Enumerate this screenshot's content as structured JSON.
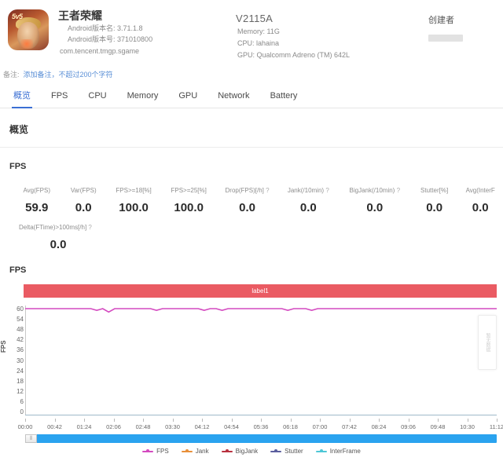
{
  "header": {
    "app": {
      "icon_name": "game-app-icon",
      "title": "王者荣耀",
      "version_name_line": "Android版本名: 3.71.1.8",
      "version_code_line": "Android版本号: 371010800",
      "package": "com.tencent.tmgp.sgame"
    },
    "device": {
      "model": "V2115A",
      "memory": "Memory: 11G",
      "cpu": "CPU: lahaina",
      "gpu": "GPU: Qualcomm Adreno (TM) 642L"
    },
    "creator": {
      "title": "创建者",
      "value": ""
    },
    "remark": {
      "label": "备注:",
      "placeholder": "添加备注，不超过200个字符"
    }
  },
  "tabs": [
    {
      "label": "概览",
      "active": true
    },
    {
      "label": "FPS",
      "active": false
    },
    {
      "label": "CPU",
      "active": false
    },
    {
      "label": "Memory",
      "active": false
    },
    {
      "label": "GPU",
      "active": false
    },
    {
      "label": "Network",
      "active": false
    },
    {
      "label": "Battery",
      "active": false
    }
  ],
  "overview": {
    "section_title": "概览"
  },
  "fps_block": {
    "title": "FPS",
    "metrics_row1": [
      {
        "label": "Avg(FPS)",
        "value": "59.9",
        "help": false
      },
      {
        "label": "Var(FPS)",
        "value": "0.0",
        "help": false
      },
      {
        "label": "FPS>=18[%]",
        "value": "100.0",
        "help": false
      },
      {
        "label": "FPS>=25[%]",
        "value": "100.0",
        "help": false
      },
      {
        "label": "Drop(FPS)[/h]",
        "value": "0.0",
        "help": true
      },
      {
        "label": "Jank(/10min)",
        "value": "0.0",
        "help": true
      },
      {
        "label": "BigJank(/10min)",
        "value": "0.0",
        "help": true
      },
      {
        "label": "Stutter[%]",
        "value": "0.0",
        "help": false
      },
      {
        "label": "Avg(InterF",
        "value": "0.0",
        "help": false
      }
    ],
    "metrics_row2": [
      {
        "label": "Delta(FTime)>100ms[/h]",
        "value": "0.0",
        "help": true
      }
    ]
  },
  "chart_section": {
    "title": "FPS",
    "band_label": "label1",
    "band_color": "#ea5b63",
    "tooltip_text": "暂无数据"
  },
  "chart_data": {
    "type": "line",
    "title": "FPS",
    "xlabel": "",
    "ylabel": "FPS",
    "ylim": [
      0,
      60
    ],
    "yticks": [
      60,
      54,
      48,
      42,
      36,
      30,
      24,
      18,
      12,
      6,
      0
    ],
    "xticks": [
      "00:00",
      "00:42",
      "01:24",
      "02:06",
      "02:48",
      "03:30",
      "04:12",
      "04:54",
      "05:36",
      "06:18",
      "07:00",
      "07:42",
      "08:24",
      "09:06",
      "09:48",
      "10:30",
      "11:12"
    ],
    "grid": false,
    "legend_position": "bottom",
    "series": [
      {
        "name": "FPS",
        "color": "#d44ac0",
        "values": [
          60,
          60,
          60,
          60,
          60,
          60,
          60,
          60,
          60,
          60,
          60,
          60,
          59,
          60,
          58,
          60,
          60,
          60,
          60,
          60,
          60,
          60,
          59,
          60,
          60,
          60,
          60,
          60,
          60,
          60,
          59,
          60,
          60,
          59,
          60,
          60,
          60,
          60,
          60,
          60,
          60,
          60,
          60,
          60,
          59,
          60,
          60,
          60,
          59,
          60,
          60,
          60,
          60,
          60,
          60,
          60,
          60,
          60,
          60,
          60,
          60,
          60,
          60,
          60,
          60,
          60,
          60,
          60,
          60,
          60,
          60,
          60,
          60,
          60,
          60,
          60,
          60,
          60,
          60,
          60
        ]
      },
      {
        "name": "Jank",
        "color": "#e8903a",
        "values": []
      },
      {
        "name": "BigJank",
        "color": "#b8313f",
        "values": []
      },
      {
        "name": "Stutter",
        "color": "#5b5f9e",
        "values": []
      },
      {
        "name": "InterFrame",
        "color": "#4ec7d6",
        "values": []
      }
    ],
    "legend": [
      {
        "name": "FPS",
        "color": "#d44ac0"
      },
      {
        "name": "Jank",
        "color": "#e8903a"
      },
      {
        "name": "BigJank",
        "color": "#b8313f"
      },
      {
        "name": "Stutter",
        "color": "#5b5f9e"
      },
      {
        "name": "InterFrame",
        "color": "#4ec7d6"
      }
    ],
    "annotations": [
      {
        "type": "band",
        "label": "label1",
        "color": "#ea5b63"
      }
    ]
  },
  "scrollbar": {
    "grip_glyph": "⦀"
  }
}
